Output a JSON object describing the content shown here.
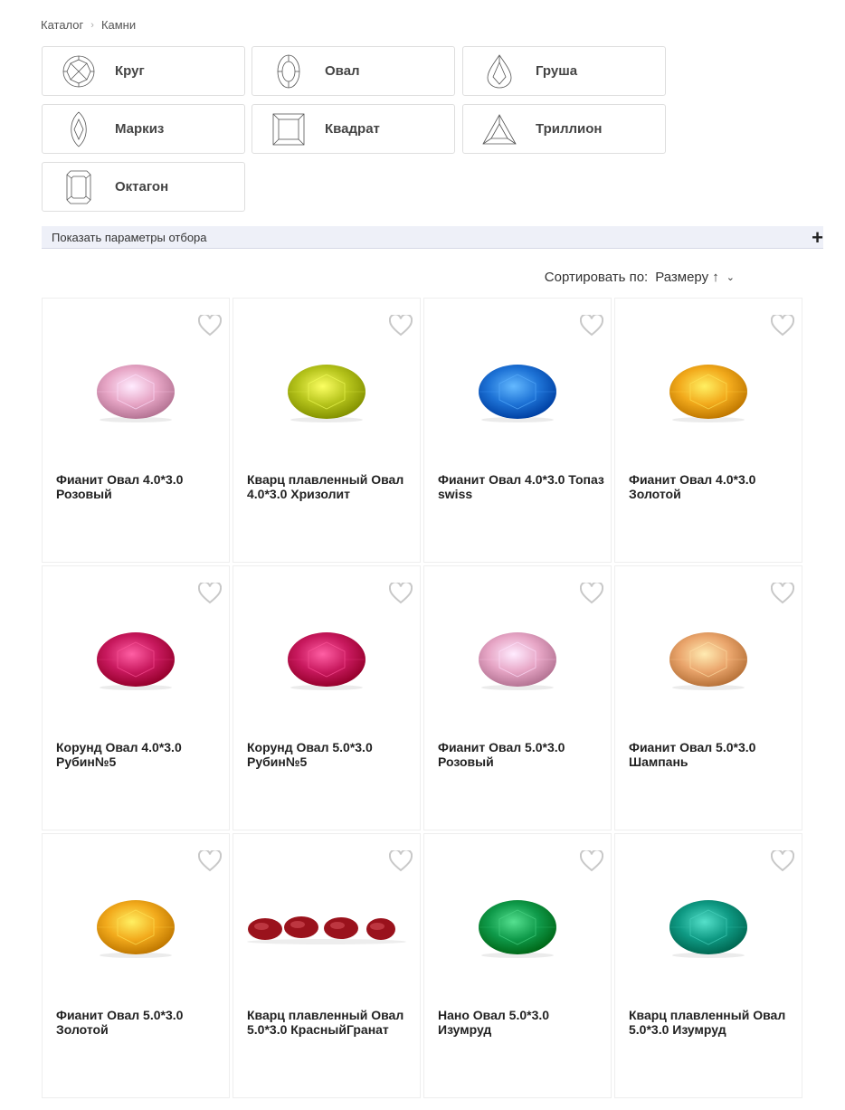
{
  "breadcrumb": {
    "home": "Каталог",
    "separator": "›",
    "current": "Камни"
  },
  "shapes": [
    {
      "label": "Круг",
      "icon": "round-cut-icon"
    },
    {
      "label": "Овал",
      "icon": "oval-cut-icon"
    },
    {
      "label": "Груша",
      "icon": "pear-cut-icon"
    },
    {
      "label": "Маркиз",
      "icon": "marquise-cut-icon"
    },
    {
      "label": "Квадрат",
      "icon": "square-cut-icon"
    },
    {
      "label": "Триллион",
      "icon": "trillion-cut-icon"
    },
    {
      "label": "Октагон",
      "icon": "octagon-cut-icon"
    }
  ],
  "filter": {
    "label": "Показать параметры отбора",
    "toggle": "+"
  },
  "sort": {
    "label": "Сортировать по:",
    "value": "Размеру ↑",
    "chevron": "⌄"
  },
  "products": [
    {
      "title": "Фианит Овал 4.0*3.0 Розовый",
      "color": "#e7a6c6"
    },
    {
      "title": "Кварц плавленный Овал 4.0*3.0 Хризолит",
      "color": "#b6c41c"
    },
    {
      "title": "Фианит Овал 4.0*3.0 Топаз swiss",
      "color": "#1e73d6"
    },
    {
      "title": "Фианит Овал 4.0*3.0 Золотой",
      "color": "#f2aa1c"
    },
    {
      "title": "Корунд Овал 4.0*3.0 Рубин№5",
      "color": "#c8195e"
    },
    {
      "title": "Корунд Овал 5.0*3.0 Рубин№5",
      "color": "#c8195e"
    },
    {
      "title": "Фианит Овал 5.0*3.0 Розовый",
      "color": "#e7a6c6"
    },
    {
      "title": "Фианит Овал 5.0*3.0 Шампань",
      "color": "#eaa56c"
    },
    {
      "title": "Фианит Овал 5.0*3.0 Золотой",
      "color": "#f2aa1c"
    },
    {
      "title": "Кварц плавленный Овал 5.0*3.0 КрасныйГранат",
      "color": "#9a121c",
      "multi": true
    },
    {
      "title": "Нано Овал 5.0*3.0 Изумруд",
      "color": "#0f9a4a"
    },
    {
      "title": "Кварц плавленный Овал 5.0*3.0 Изумруд",
      "color": "#0f9a84"
    }
  ],
  "colors": {
    "card_border": "#eeeeee",
    "filter_bg": "#eef0f8",
    "heart": "#c8c8c8"
  }
}
